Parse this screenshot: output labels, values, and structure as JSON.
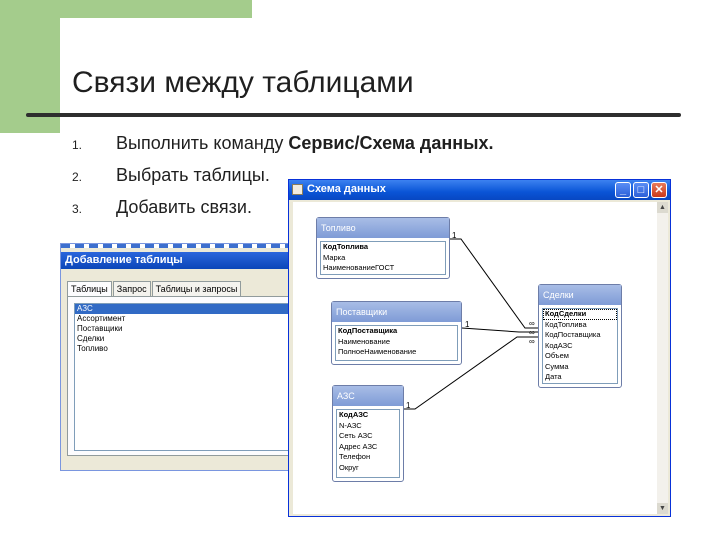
{
  "slide": {
    "title": "Связи между таблицами",
    "steps": [
      {
        "num": "1.",
        "text": "Выполнить команду ",
        "bold": "Сервис/Схема данных."
      },
      {
        "num": "2.",
        "text": "Выбрать таблицы.",
        "bold": ""
      },
      {
        "num": "3.",
        "text": "Добавить связи.",
        "bold": ""
      }
    ]
  },
  "add_dialog": {
    "title": "Добавление таблицы",
    "tabs": [
      "Таблицы",
      "Запрос",
      "Таблицы и запросы"
    ],
    "items": [
      "АЗС",
      "Ассортимент",
      "Поставщики",
      "Сделки",
      "Топливо"
    ]
  },
  "rel_window": {
    "title": "Схема данных",
    "buttons": {
      "minimize": "_",
      "maximize": "□",
      "close": "✕"
    },
    "tables": [
      {
        "name": "Топливо",
        "fields": [
          "КодТоплива",
          "Марка",
          "НаименованиеГОСТ"
        ]
      },
      {
        "name": "Поставщики",
        "fields": [
          "КодПоставщика",
          "Наименование",
          "ПолноеНаименование"
        ]
      },
      {
        "name": "АЗС",
        "fields": [
          "КодАЗС",
          "N-АЗС",
          "Сеть АЗС",
          "Адрес АЗС",
          "Телефон",
          "Округ"
        ]
      },
      {
        "name": "Сделки",
        "fields": [
          "КодСделки",
          "КодТоплива",
          "КодПоставщика",
          "КодАЗС",
          "Объем",
          "Сумма",
          "Дата"
        ]
      }
    ],
    "relation_labels": {
      "one": "1",
      "many": "∞"
    }
  },
  "colors": {
    "accent_green": "#a4cc8c",
    "xp_blue": "#0a54d6",
    "table_header": "#8fa8dd"
  }
}
